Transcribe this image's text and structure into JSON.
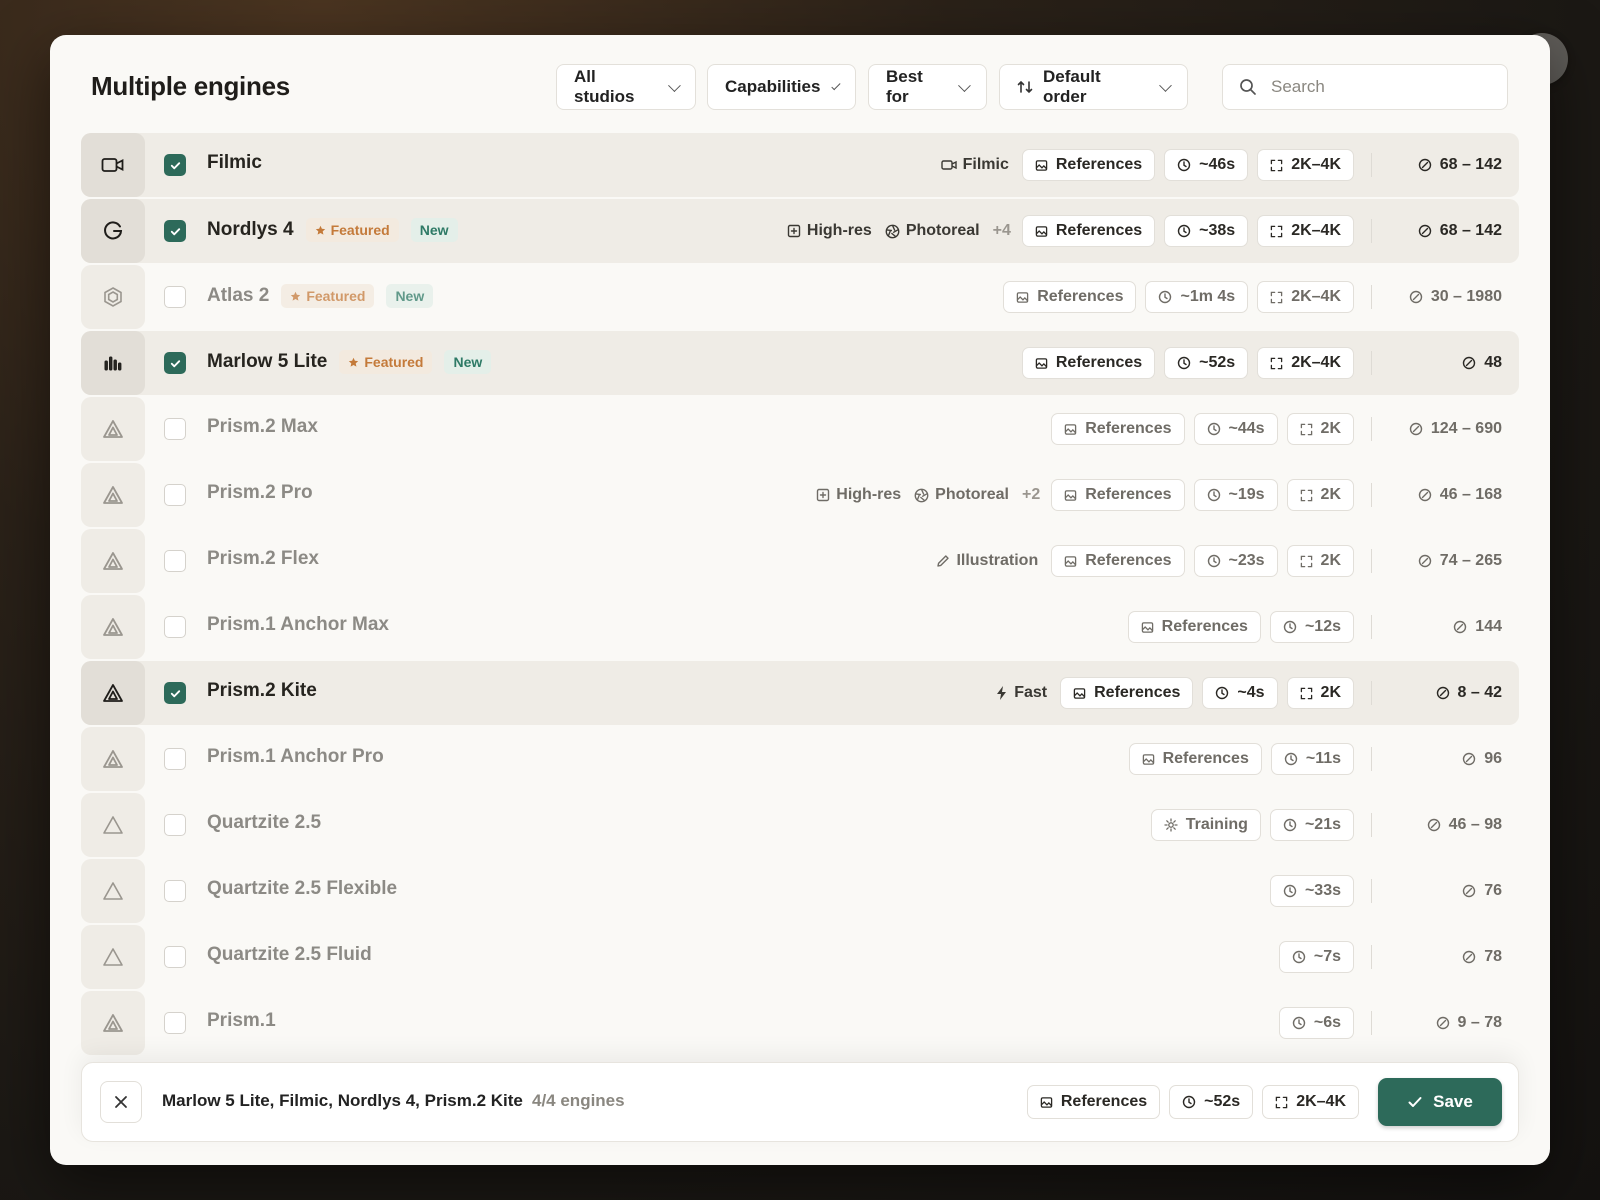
{
  "header": {
    "title": "Multiple engines",
    "filters": {
      "studios": "All studios",
      "capabilities": "Capabilities",
      "best_for": "Best for",
      "order": "Default order"
    },
    "search_placeholder": "Search"
  },
  "engines": [
    {
      "name": "Filmic",
      "selected": true,
      "icon": "video-camera-icon",
      "featured": false,
      "is_new": false,
      "caps": [
        {
          "icon": "video-icon",
          "label": "Filmic"
        }
      ],
      "more": "",
      "references": "References",
      "time": "~46s",
      "resolution": "2K–4K",
      "cost": "68 – 142"
    },
    {
      "name": "Nordlys 4",
      "selected": true,
      "icon": "g-logo-icon",
      "featured": true,
      "is_new": true,
      "caps": [
        {
          "icon": "high-res-icon",
          "label": "High-res"
        },
        {
          "icon": "aperture-icon",
          "label": "Photoreal"
        }
      ],
      "more": "+4",
      "references": "References",
      "time": "~38s",
      "resolution": "2K–4K",
      "cost": "68 – 142"
    },
    {
      "name": "Atlas 2",
      "selected": false,
      "icon": "hexagon-icon",
      "featured": true,
      "is_new": true,
      "caps": [],
      "more": "",
      "references": "References",
      "time": "~1m 4s",
      "resolution": "2K–4K",
      "cost": "30 – 1980"
    },
    {
      "name": "Marlow 5 Lite",
      "selected": true,
      "icon": "bars-icon",
      "featured": true,
      "is_new": true,
      "caps": [],
      "more": "",
      "references": "References",
      "time": "~52s",
      "resolution": "2K–4K",
      "cost": "48"
    },
    {
      "name": "Prism.2 Max",
      "selected": false,
      "icon": "prism-icon",
      "featured": false,
      "is_new": false,
      "caps": [],
      "more": "",
      "references": "References",
      "time": "~44s",
      "resolution": "2K",
      "cost": "124 – 690"
    },
    {
      "name": "Prism.2 Pro",
      "selected": false,
      "icon": "prism-icon",
      "featured": false,
      "is_new": false,
      "caps": [
        {
          "icon": "high-res-icon",
          "label": "High-res"
        },
        {
          "icon": "aperture-icon",
          "label": "Photoreal"
        }
      ],
      "more": "+2",
      "references": "References",
      "time": "~19s",
      "resolution": "2K",
      "cost": "46 – 168"
    },
    {
      "name": "Prism.2 Flex",
      "selected": false,
      "icon": "prism-icon",
      "featured": false,
      "is_new": false,
      "caps": [
        {
          "icon": "pencil-icon",
          "label": "Illustration"
        }
      ],
      "more": "",
      "references": "References",
      "time": "~23s",
      "resolution": "2K",
      "cost": "74 – 265"
    },
    {
      "name": "Prism.1 Anchor Max",
      "selected": false,
      "icon": "prism-icon",
      "featured": false,
      "is_new": false,
      "caps": [],
      "more": "",
      "references": "References",
      "time": "~12s",
      "resolution": "",
      "cost": "144"
    },
    {
      "name": "Prism.2 Kite",
      "selected": true,
      "icon": "prism-icon",
      "featured": false,
      "is_new": false,
      "caps": [
        {
          "icon": "bolt-icon",
          "label": "Fast"
        }
      ],
      "more": "",
      "references": "References",
      "time": "~4s",
      "resolution": "2K",
      "cost": "8 – 42"
    },
    {
      "name": "Prism.1 Anchor Pro",
      "selected": false,
      "icon": "prism-icon",
      "featured": false,
      "is_new": false,
      "caps": [],
      "more": "",
      "references": "References",
      "time": "~11s",
      "resolution": "",
      "cost": "96"
    },
    {
      "name": "Quartzite 2.5",
      "selected": false,
      "icon": "triangle-icon",
      "featured": false,
      "is_new": false,
      "caps": [],
      "more": "",
      "references": "",
      "training": "Training",
      "time": "~21s",
      "resolution": "",
      "cost": "46 – 98"
    },
    {
      "name": "Quartzite 2.5 Flexible",
      "selected": false,
      "icon": "triangle-icon",
      "featured": false,
      "is_new": false,
      "caps": [],
      "more": "",
      "references": "",
      "time": "~33s",
      "resolution": "",
      "cost": "76"
    },
    {
      "name": "Quartzite 2.5 Fluid",
      "selected": false,
      "icon": "triangle-icon",
      "featured": false,
      "is_new": false,
      "caps": [],
      "more": "",
      "references": "",
      "time": "~7s",
      "resolution": "",
      "cost": "78"
    },
    {
      "name": "Prism.1",
      "selected": false,
      "icon": "prism-icon",
      "featured": false,
      "is_new": false,
      "caps": [],
      "more": "",
      "references": "",
      "time": "~6s",
      "resolution": "",
      "cost": "9 – 78"
    }
  ],
  "labels": {
    "featured": "Featured",
    "new": "New"
  },
  "footer": {
    "selection": "Marlow 5 Lite, Filmic, Nordlys 4, Prism.2 Kite",
    "count": "4/4 engines",
    "references": "References",
    "time": "~52s",
    "resolution": "2K–4K",
    "save": "Save"
  },
  "colors": {
    "accent": "#2d6a5a",
    "featured": "#c47a3a",
    "new": "#2e7a66",
    "selected_row": "#efece6"
  }
}
